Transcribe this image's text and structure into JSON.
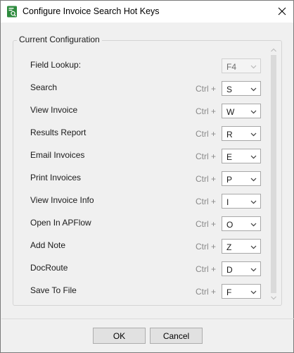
{
  "window": {
    "title": "Configure Invoice Search Hot Keys"
  },
  "group": {
    "label": "Current Configuration"
  },
  "modifier": "Ctrl +",
  "hotkeys": [
    {
      "label": "Field Lookup:",
      "key": "F4",
      "disabled": true
    },
    {
      "label": "Search",
      "key": "S"
    },
    {
      "label": "View Invoice",
      "key": "W"
    },
    {
      "label": "Results Report",
      "key": "R"
    },
    {
      "label": "Email Invoices",
      "key": "E"
    },
    {
      "label": "Print Invoices",
      "key": "P"
    },
    {
      "label": "View Invoice Info",
      "key": "I"
    },
    {
      "label": "Open In APFlow",
      "key": "O"
    },
    {
      "label": "Add Note",
      "key": "Z"
    },
    {
      "label": "DocRoute",
      "key": "D"
    },
    {
      "label": "Save To File",
      "key": "F"
    }
  ],
  "buttons": {
    "ok": "OK",
    "cancel": "Cancel"
  },
  "colors": {
    "app_icon": "#2e8b3e"
  }
}
